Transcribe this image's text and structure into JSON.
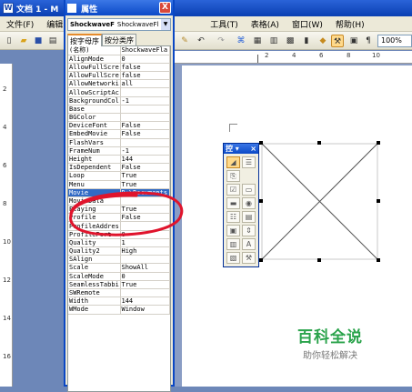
{
  "window": {
    "title": "文档 1 - M"
  },
  "menubar": {
    "items": [
      "文件(F)",
      "编辑",
      "工具(T)",
      "表格(A)",
      "窗口(W)",
      "帮助(H)"
    ]
  },
  "toolbar": {
    "zoom": "100%"
  },
  "ruler": {
    "h_marks": [
      "2",
      "4",
      "6",
      "8",
      "10"
    ],
    "v_marks": [
      "2",
      "4",
      "6",
      "8",
      "10",
      "12",
      "14",
      "16"
    ]
  },
  "properties": {
    "title": "属性",
    "close_label": "X",
    "object_name": "ShockwaveF",
    "object_type": "ShockwaveFl",
    "tabs": [
      "按字母序",
      "按分类序"
    ],
    "rows": [
      {
        "name": "(名称)",
        "value": "ShockwaveFla"
      },
      {
        "name": "AlignMode",
        "value": "0"
      },
      {
        "name": "AllowFullScre",
        "value": "false"
      },
      {
        "name": "AllowFullScre",
        "value": "false"
      },
      {
        "name": "AllowNetworki",
        "value": "all"
      },
      {
        "name": "AllowScriptAc",
        "value": ""
      },
      {
        "name": "BackgroundCol",
        "value": "-1"
      },
      {
        "name": "Base",
        "value": ""
      },
      {
        "name": "BGColor",
        "value": ""
      },
      {
        "name": "DeviceFont",
        "value": "False"
      },
      {
        "name": "EmbedMovie",
        "value": "False"
      },
      {
        "name": "FlashVars",
        "value": ""
      },
      {
        "name": "FrameNum",
        "value": "-1"
      },
      {
        "name": "Height",
        "value": "144"
      },
      {
        "name": "IsDependent",
        "value": "False"
      },
      {
        "name": "Loop",
        "value": "True"
      },
      {
        "name": "Menu",
        "value": "True"
      },
      {
        "name": "Movie",
        "value": "D:\\Documents"
      },
      {
        "name": "MovieData",
        "value": ""
      },
      {
        "name": "Playing",
        "value": "True"
      },
      {
        "name": "Profile",
        "value": "False"
      },
      {
        "name": "ProfileAddres",
        "value": ""
      },
      {
        "name": "ProfilePort",
        "value": "0"
      },
      {
        "name": "Quality",
        "value": "1"
      },
      {
        "name": "Quality2",
        "value": "High"
      },
      {
        "name": "SAlign",
        "value": ""
      },
      {
        "name": "Scale",
        "value": "ShowAll"
      },
      {
        "name": "ScaleMode",
        "value": "0"
      },
      {
        "name": "SeamlessTabbi",
        "value": "True"
      },
      {
        "name": "SWRemote",
        "value": ""
      },
      {
        "name": "Width",
        "value": "144"
      },
      {
        "name": "WMode",
        "value": "Window"
      }
    ],
    "selected_row": 17
  },
  "toolbox": {
    "title": "控",
    "tools": [
      "select-icon",
      "properties-icon",
      "view-code-icon",
      "checkbox-icon",
      "textbox-icon",
      "command-button-icon",
      "option-button-icon",
      "listbox-icon",
      "combobox-icon",
      "toggle-button-icon",
      "spin-button-icon",
      "scrollbar-icon",
      "label-icon",
      "image-icon",
      "more-controls-icon"
    ]
  },
  "watermark": {
    "line1": "百科全说",
    "line2": "助你轻松解决"
  },
  "colors": {
    "annotation": "#e0142c",
    "selection": "#316ac5",
    "titlebar": "#0a47c4"
  }
}
